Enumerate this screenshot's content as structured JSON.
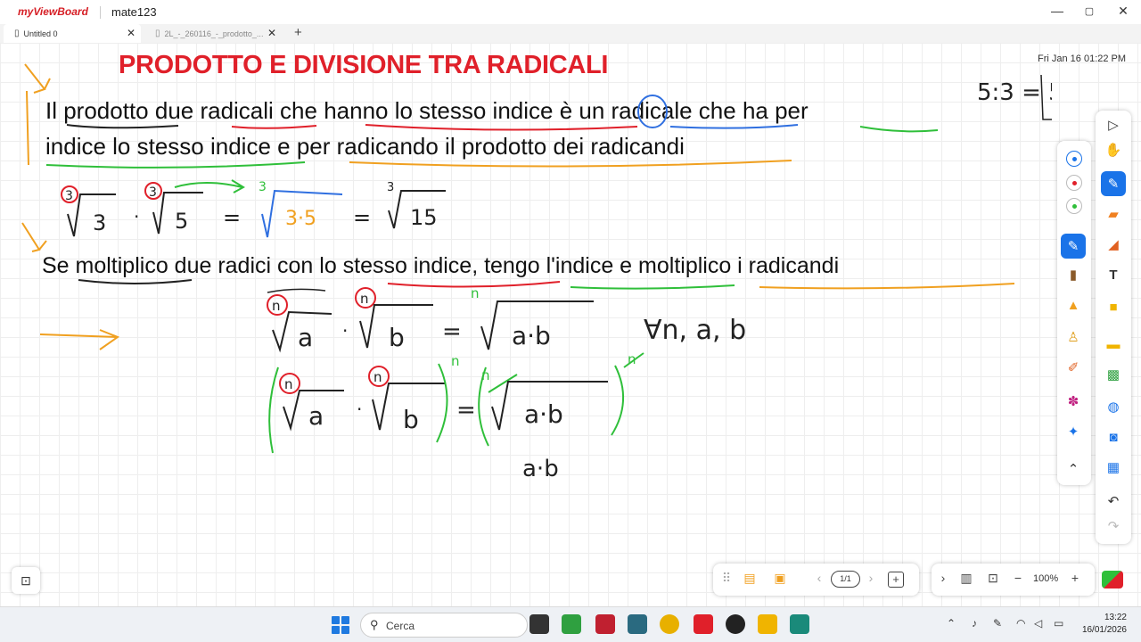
{
  "window": {
    "brand": "myViewBoard",
    "title": "mate123",
    "minimize": "—",
    "maximize": "▢",
    "close": "✕"
  },
  "tabs": [
    {
      "label": "Untitled 0",
      "close": "✕"
    },
    {
      "label": "2L_-_260116_-_prodotto_...",
      "close": "✕"
    }
  ],
  "tab_add": "+",
  "board": {
    "heading": "PRODOTTO E DIVISIONE TRA RADICALI",
    "paragraph_line1": "Il prodotto due radicali che hanno lo stesso indice è un radicale che ha per",
    "paragraph_line2": "indice lo stesso indice e per radicando il prodotto dei radicandi",
    "rule_line": "Se moltiplico due radici con lo stesso indice, tengo l'indice e moltiplico i radicandi",
    "datetime": "Fri Jan 16  01:22 PM",
    "ink_colors": {
      "black": "#222222",
      "red": "#e0202a",
      "green": "#2fbf3a",
      "blue": "#2f6fe0",
      "orange": "#f0a020"
    },
    "handwritten": {
      "example_root1_index": "3",
      "example_root1_radicand": "3",
      "example_root2_index": "3",
      "example_root2_radicand": "5",
      "example_result_index": "3",
      "example_result_radicand": "3·5",
      "example_final_index": "3",
      "example_final_radicand": "15",
      "general_index": "n",
      "general_radicand_a": "a",
      "general_radicand_b": "b",
      "general_product": "a·b",
      "forall": "∀n, a, b",
      "power_exponent": "n",
      "side_note": "5:3 = 5·1/3"
    }
  },
  "color_dots": [
    "#1a73e8",
    "#e0202a",
    "#2fbf3a"
  ],
  "tools_left": [
    "pen-icon",
    "marker-icon",
    "highlighter-icon",
    "brush-icon",
    "crayon-icon",
    "magic-pen-icon",
    "sparkle-pen-icon",
    "collapse-icon"
  ],
  "tools_right": [
    "select-icon",
    "hand-icon",
    "pen-icon",
    "eraser-icon",
    "shape-icon",
    "text-icon",
    "sticky-note-icon",
    "folder-icon",
    "toolbox-icon",
    "globe-icon",
    "camera-icon",
    "apps-icon",
    "undo-icon",
    "redo-icon"
  ],
  "page_nav": {
    "prev": "‹",
    "indicator": "1/1",
    "next": "›",
    "add": "+"
  },
  "zoom": {
    "value": "100%",
    "minus": "−",
    "plus": "+"
  },
  "taskbar": {
    "search_placeholder": "Cerca",
    "time": "13:22",
    "date": "16/01/2026"
  }
}
